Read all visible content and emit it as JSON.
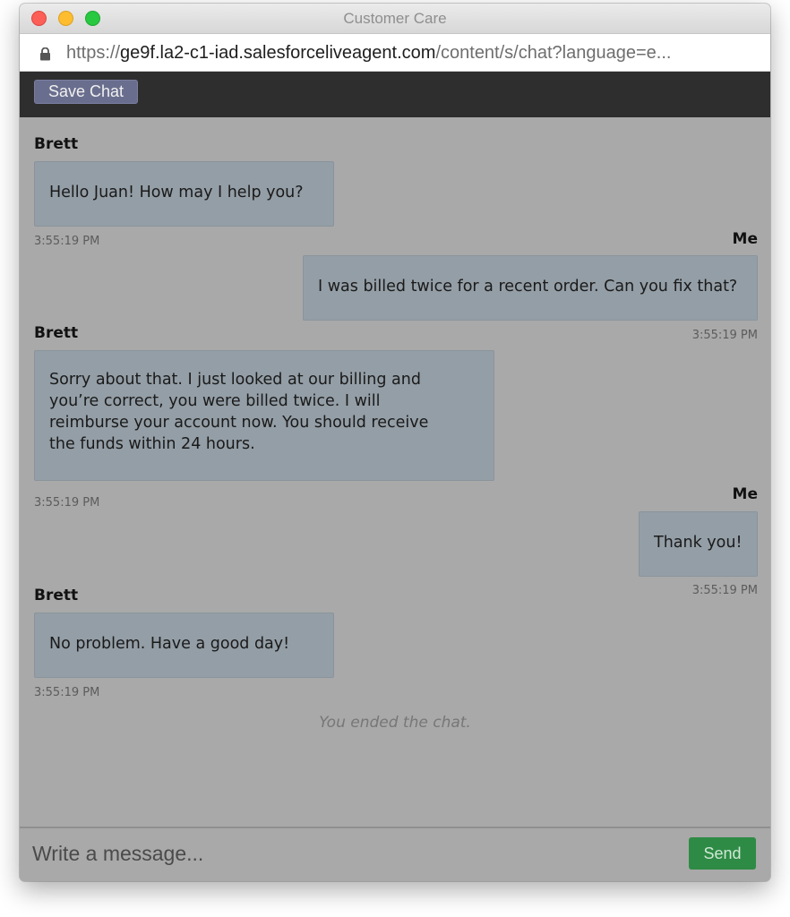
{
  "window": {
    "title": "Customer Care"
  },
  "address_bar": {
    "scheme": "https://",
    "host": "ge9f.la2-c1-iad.salesforceliveagent.com",
    "path": "/content/s/chat?language=e..."
  },
  "toolbar": {
    "save_label": "Save Chat"
  },
  "messages": [
    {
      "sender": "Brett",
      "text": "Hello Juan! How may I help you?",
      "time": "3:55:19 PM"
    },
    {
      "sender": "Me",
      "text": "I was billed twice for a recent order. Can you fix that?",
      "time": "3:55:19 PM"
    },
    {
      "sender": "Brett",
      "text": "Sorry about that. I just looked at our billing and you’re correct, you were billed twice. I will reimburse your account now. You should receive the funds within 24 hours.",
      "time": "3:55:19 PM"
    },
    {
      "sender": "Me",
      "text": "Thank you!",
      "time": "3:55:19 PM"
    },
    {
      "sender": "Brett",
      "text": "No problem. Have a good day!",
      "time": "3:55:19 PM"
    }
  ],
  "chat_status": "You ended the chat.",
  "composer": {
    "placeholder": "Write a message...",
    "send_label": "Send"
  },
  "colors": {
    "agent_bubble": "#949ea6",
    "send_button": "#2e8b45",
    "save_button": "#6a6e8e"
  },
  "icons": {
    "lock": "lock-icon"
  }
}
